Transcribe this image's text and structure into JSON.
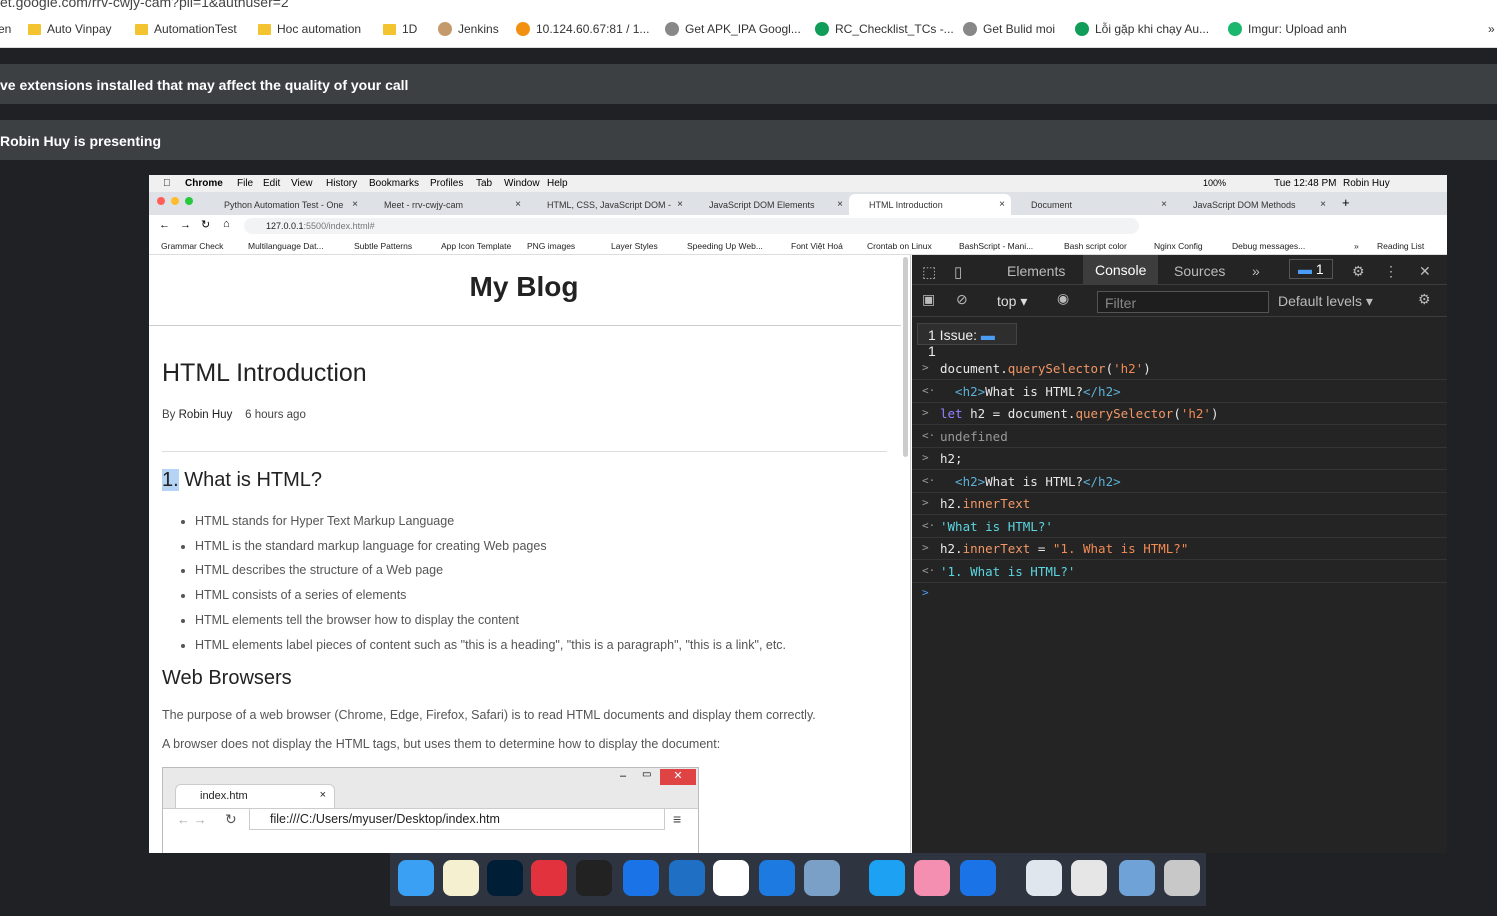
{
  "outer": {
    "url_fragment": "et.google.com/rrv-cwjy-cam?pli=1&authuser=2",
    "bookmarks": [
      {
        "label": "en",
        "kind": "text"
      },
      {
        "label": "Auto Vinpay",
        "kind": "folder"
      },
      {
        "label": "AutomationTest",
        "kind": "folder"
      },
      {
        "label": "Hoc automation",
        "kind": "folder"
      },
      {
        "label": "1D",
        "kind": "folder"
      },
      {
        "label": "Jenkins",
        "kind": "jenkins"
      },
      {
        "label": "10.124.60.67:81 / 1...",
        "kind": "pma"
      },
      {
        "label": "Get APK_IPA Googl...",
        "kind": "gear"
      },
      {
        "label": "RC_Checklist_TCs -...",
        "kind": "sheet"
      },
      {
        "label": "Get Bulid moi",
        "kind": "gear"
      },
      {
        "label": "Lỗi gặp khi chạy Au...",
        "kind": "sheet"
      },
      {
        "label": "Imgur: Upload anh",
        "kind": "imgur"
      }
    ],
    "close_glyph": "»"
  },
  "meet": {
    "banner_ext": "ve extensions installed that may affect the quality of your call",
    "banner_presenting": "Robin Huy is presenting"
  },
  "mac": {
    "menu": [
      "Chrome",
      "File",
      "Edit",
      "View",
      "History",
      "Bookmarks",
      "Profiles",
      "Tab",
      "Window",
      "Help"
    ],
    "battery": "100%",
    "clock": "Tue 12:48 PM",
    "user": "Robin Huy"
  },
  "tabs": [
    {
      "title": "Python Automation Test - One"
    },
    {
      "title": "Meet - rrv-cwjy-cam"
    },
    {
      "title": "HTML, CSS, JavaScript DOM -"
    },
    {
      "title": "JavaScript DOM Elements"
    },
    {
      "title": "HTML Introduction",
      "active": true
    },
    {
      "title": "Document"
    },
    {
      "title": "JavaScript DOM Methods"
    }
  ],
  "address": {
    "host": "127.0.0.1",
    "rest": ":5500/index.html#"
  },
  "inner_bookmarks": [
    "Grammar Check",
    "Multilanguage Dat...",
    "Subtle Patterns",
    "App Icon Template",
    "PNG images",
    "Layer Styles",
    "Speeding Up Web...",
    "Font Việt Hoá",
    "Crontab on Linux",
    "BashScript - Mani...",
    "Bash script color",
    "Nginx Config",
    "Debug messages...",
    "»",
    "Reading List"
  ],
  "page": {
    "blog_title": "My Blog",
    "article_title": "HTML Introduction",
    "by": "By",
    "author": "Robin Huy",
    "time": "6 hours ago",
    "h2_num": "1.",
    "h2_text": " What is HTML?",
    "bullets": [
      "HTML stands for Hyper Text Markup Language",
      "HTML is the standard markup language for creating Web pages",
      "HTML describes the structure of a Web page",
      "HTML consists of a series of elements",
      "HTML elements tell the browser how to display the content",
      "HTML elements label pieces of content such as \"this is a heading\", \"this is a paragraph\", \"this is a link\", etc."
    ],
    "h2_browsers": "Web Browsers",
    "p1": "The purpose of a web browser (Chrome, Edge, Firefox, Safari) is to read HTML documents and display them correctly.",
    "p2": "A browser does not display the HTML tags, but uses them to determine how to display the document:",
    "shot_tab": "index.htm",
    "shot_url": "file:///C:/Users/myuser/Desktop/index.htm"
  },
  "devtools": {
    "tabs": [
      "Elements",
      "Console",
      "Sources"
    ],
    "more": "»",
    "badge": "1",
    "context": "top",
    "filter_placeholder": "Filter",
    "levels": "Default levels",
    "issue_label": "1 Issue:",
    "issue_count": "1",
    "console": [
      {
        "arrow": ">",
        "parts": [
          [
            "w",
            "document."
          ],
          [
            "o",
            "querySelector"
          ],
          [
            "w",
            "("
          ],
          [
            "s",
            "'h2'"
          ],
          [
            "w",
            ")"
          ]
        ]
      },
      {
        "arrow": "<·",
        "parts": [
          [
            "tg",
            "  <h2>"
          ],
          [
            "w",
            "What is HTML?"
          ],
          [
            "tg",
            "</h2>"
          ]
        ]
      },
      {
        "arrow": ">",
        "parts": [
          [
            "kw",
            "let"
          ],
          [
            "w",
            " h2 = document."
          ],
          [
            "o",
            "querySelector"
          ],
          [
            "w",
            "("
          ],
          [
            "s",
            "'h2'"
          ],
          [
            "w",
            ")"
          ]
        ]
      },
      {
        "arrow": "<·",
        "parts": [
          [
            "gr",
            "undefined"
          ]
        ]
      },
      {
        "arrow": ">",
        "parts": [
          [
            "w",
            "h2;"
          ]
        ]
      },
      {
        "arrow": "<·",
        "parts": [
          [
            "tg",
            "  <h2>"
          ],
          [
            "w",
            "What is HTML?"
          ],
          [
            "tg",
            "</h2>"
          ]
        ]
      },
      {
        "arrow": ">",
        "parts": [
          [
            "w",
            "h2."
          ],
          [
            "o",
            "innerText"
          ]
        ]
      },
      {
        "arrow": "<·",
        "parts": [
          [
            "cy",
            "'What is HTML?'"
          ]
        ]
      },
      {
        "arrow": ">",
        "parts": [
          [
            "w",
            "h2."
          ],
          [
            "o",
            "innerText"
          ],
          [
            "w",
            " = "
          ],
          [
            "s",
            "\"1. What is HTML?\""
          ]
        ]
      },
      {
        "arrow": "<·",
        "parts": [
          [
            "cy",
            "'1. What is HTML?'"
          ]
        ]
      },
      {
        "arrow": ">",
        "parts": []
      }
    ]
  },
  "dock": [
    "Finder",
    "Notes",
    "Photoshop",
    "Speeko",
    "Terminal",
    "Zalo",
    "VS Code",
    "Chrome",
    "Xcode",
    "Preview",
    "Skype",
    "Folder",
    "Zalo",
    "Finder window",
    "Window",
    "Chrome",
    "Trash"
  ]
}
